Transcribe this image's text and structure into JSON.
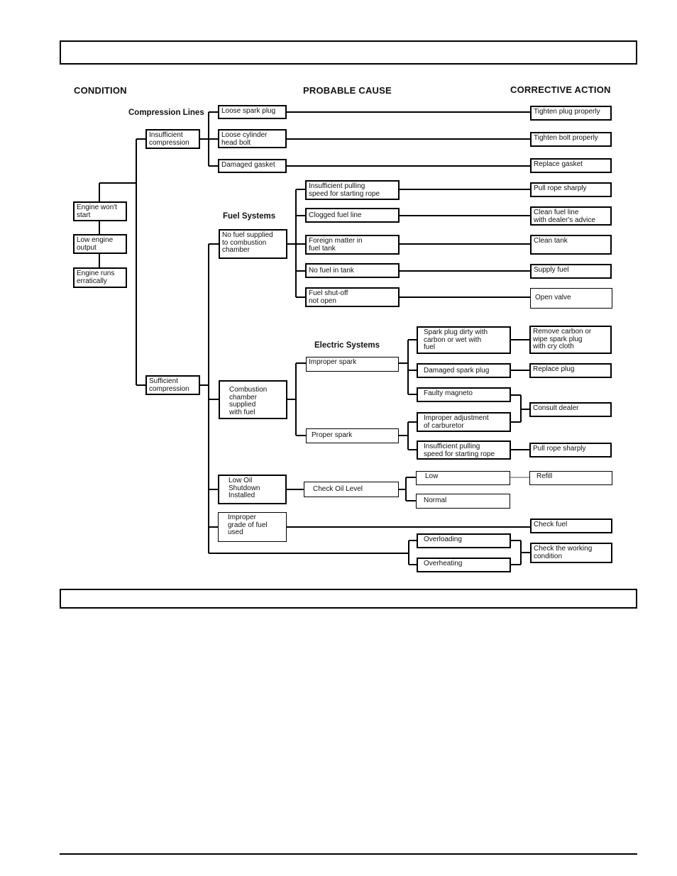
{
  "headers": {
    "condition": "CONDITION",
    "probable_cause": "PROBABLE CAUSE",
    "corrective_action": "CORRECTIVE ACTION"
  },
  "sections": {
    "compression": "Compression Lines",
    "fuel": "Fuel Systems",
    "electric": "Electric Systems"
  },
  "conditions": [
    "Engine won't\nstart",
    "Low engine\noutput",
    "Engine runs\nerratically"
  ],
  "compression_states": {
    "insufficient": "Insufficient\ncompression",
    "sufficient": "Sufficient\ncompression"
  },
  "compression_causes": [
    {
      "cause": "Loose spark plug",
      "action": "Tighten plug properly"
    },
    {
      "cause": "Loose cylinder\nhead bolt",
      "action": "Tighten bolt properly"
    },
    {
      "cause": "Damaged gasket",
      "action": "Replace gasket"
    }
  ],
  "fuel": {
    "group": "No fuel supplied\nto combustion\nchamber",
    "causes": [
      {
        "cause": "Insufficient pulling\nspeed for starting rope",
        "action": "Pull rope sharply"
      },
      {
        "cause": "Clogged fuel line",
        "action": "Clean fuel line\nwith dealer's advice"
      },
      {
        "cause": "Foreign matter in\nfuel tank",
        "action": "Clean tank"
      },
      {
        "cause": "No fuel in tank",
        "action": "Supply fuel"
      },
      {
        "cause": "Fuel shut-off\nnot open",
        "action": "Open valve"
      }
    ]
  },
  "electric": {
    "group": "Combustion\nchamber\nsupplied\nwith fuel",
    "improper_spark": "Improper spark",
    "proper_spark": "Proper spark",
    "improper_causes": [
      {
        "cause": "Spark plug dirty with\ncarbon or wet with\nfuel",
        "action": "Remove carbon or\nwipe spark plug\nwith cry cloth"
      },
      {
        "cause": "Damaged spark plug",
        "action": "Replace plug"
      },
      {
        "cause": "Faulty magneto"
      }
    ],
    "proper_causes": [
      {
        "cause": "Improper adjustment\nof carburetor"
      },
      {
        "cause": "Insufficient pulling\nspeed for starting rope",
        "action": "Pull rope sharply"
      }
    ],
    "shared_action": "Consult dealer"
  },
  "oil": {
    "group": "Low Oil\nShutdown\nInstalled",
    "check": "Check Oil Level",
    "low": "Low",
    "low_action": "Refill",
    "normal": "Normal"
  },
  "fuel_grade": {
    "cause": "Improper\ngrade of fuel\nused",
    "action": "Check fuel"
  },
  "working": {
    "overloading": "Overloading",
    "overheating": "Overheating",
    "action": "Check the working\ncondition"
  }
}
